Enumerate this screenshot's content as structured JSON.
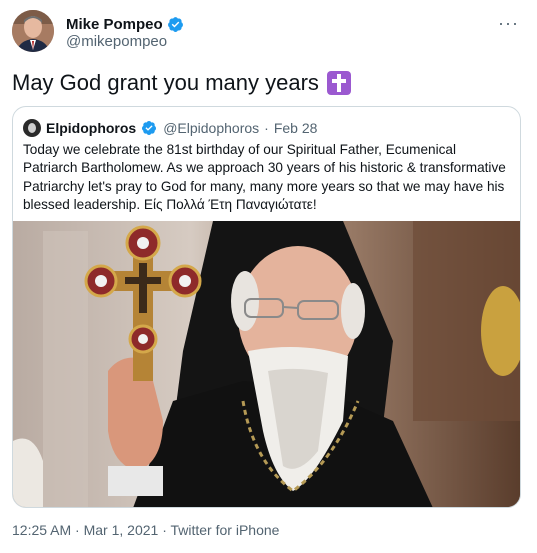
{
  "author": {
    "name": "Mike Pompeo",
    "handle": "@mikepompeo"
  },
  "tweet_text": "May God grant you many years",
  "more_label": "···",
  "quoted": {
    "name": "Elpidophoros",
    "handle": "@Elpidophoros",
    "separator": "·",
    "date": "Feb 28",
    "text": "Today we celebrate the 81st birthday of our Spiritual Father, Ecumenical Patriarch Bartholomew. As we approach 30 years of his historic & transformative Patriarchy let's pray to God for many, many more years so that we may have his blessed leadership. Είς Πολλά Έτη Παναγιώτατε!"
  },
  "meta": "12:25 AM · Mar 1, 2021 · Twitter for iPhone",
  "colors": {
    "verified": "#1d9bf0",
    "text": "#0f1419",
    "secondary": "#536471",
    "border": "#cfd9de"
  },
  "icons": [
    "verified-badge-icon",
    "more-options-icon",
    "latin-cross-emoji"
  ]
}
